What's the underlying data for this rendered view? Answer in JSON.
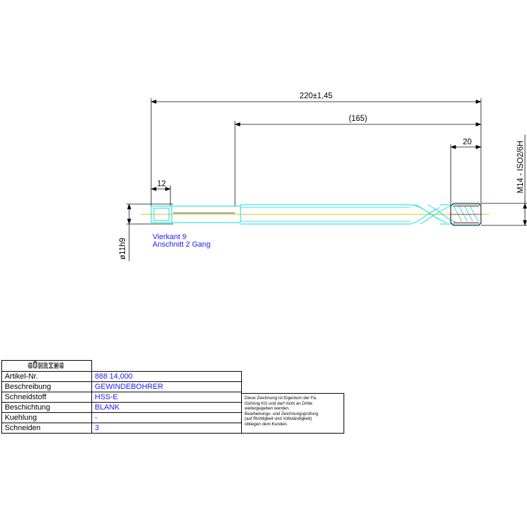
{
  "dimensions": {
    "overall_length": "220±1,45",
    "thread_length": "(165)",
    "chamfer_length": "20",
    "square_length": "12",
    "thread_spec": "M14 - ISO2/6H",
    "shank_diameter": "ø11h9"
  },
  "annotations": {
    "square": "Vierkant 9",
    "chamfer": "Anschnitt 2 Gang"
  },
  "title_block": {
    "logo": "GÜHRING",
    "rows": [
      {
        "label": "Artikel-Nr.",
        "value": "888 14,000"
      },
      {
        "label": "Beschreibung",
        "value": "GEWINDEBOHRER"
      },
      {
        "label": "Schneidstoff",
        "value": "HSS-E"
      },
      {
        "label": "Beschichtung",
        "value": "BLANK"
      },
      {
        "label": "Kuehlung",
        "value": "-"
      },
      {
        "label": "Schneiden",
        "value": "3"
      }
    ]
  },
  "notice": {
    "lines": [
      "Diese Zeichnung ist Eigentum der Fa.",
      "Gühring KG und darf nicht an Dritte",
      "weitergegeben werden.",
      "Bearbeitungs- und Zeichnungsprüfung",
      "(auf Richtigkeit und Vollständigkeit)",
      "obliegen dem Kunden."
    ]
  },
  "colors": {
    "outline": "#00e0e0",
    "centerline": "#e6c200",
    "text_blue": "#1a1aff",
    "dimension": "#000000",
    "tip_accent": "#cc0000"
  }
}
